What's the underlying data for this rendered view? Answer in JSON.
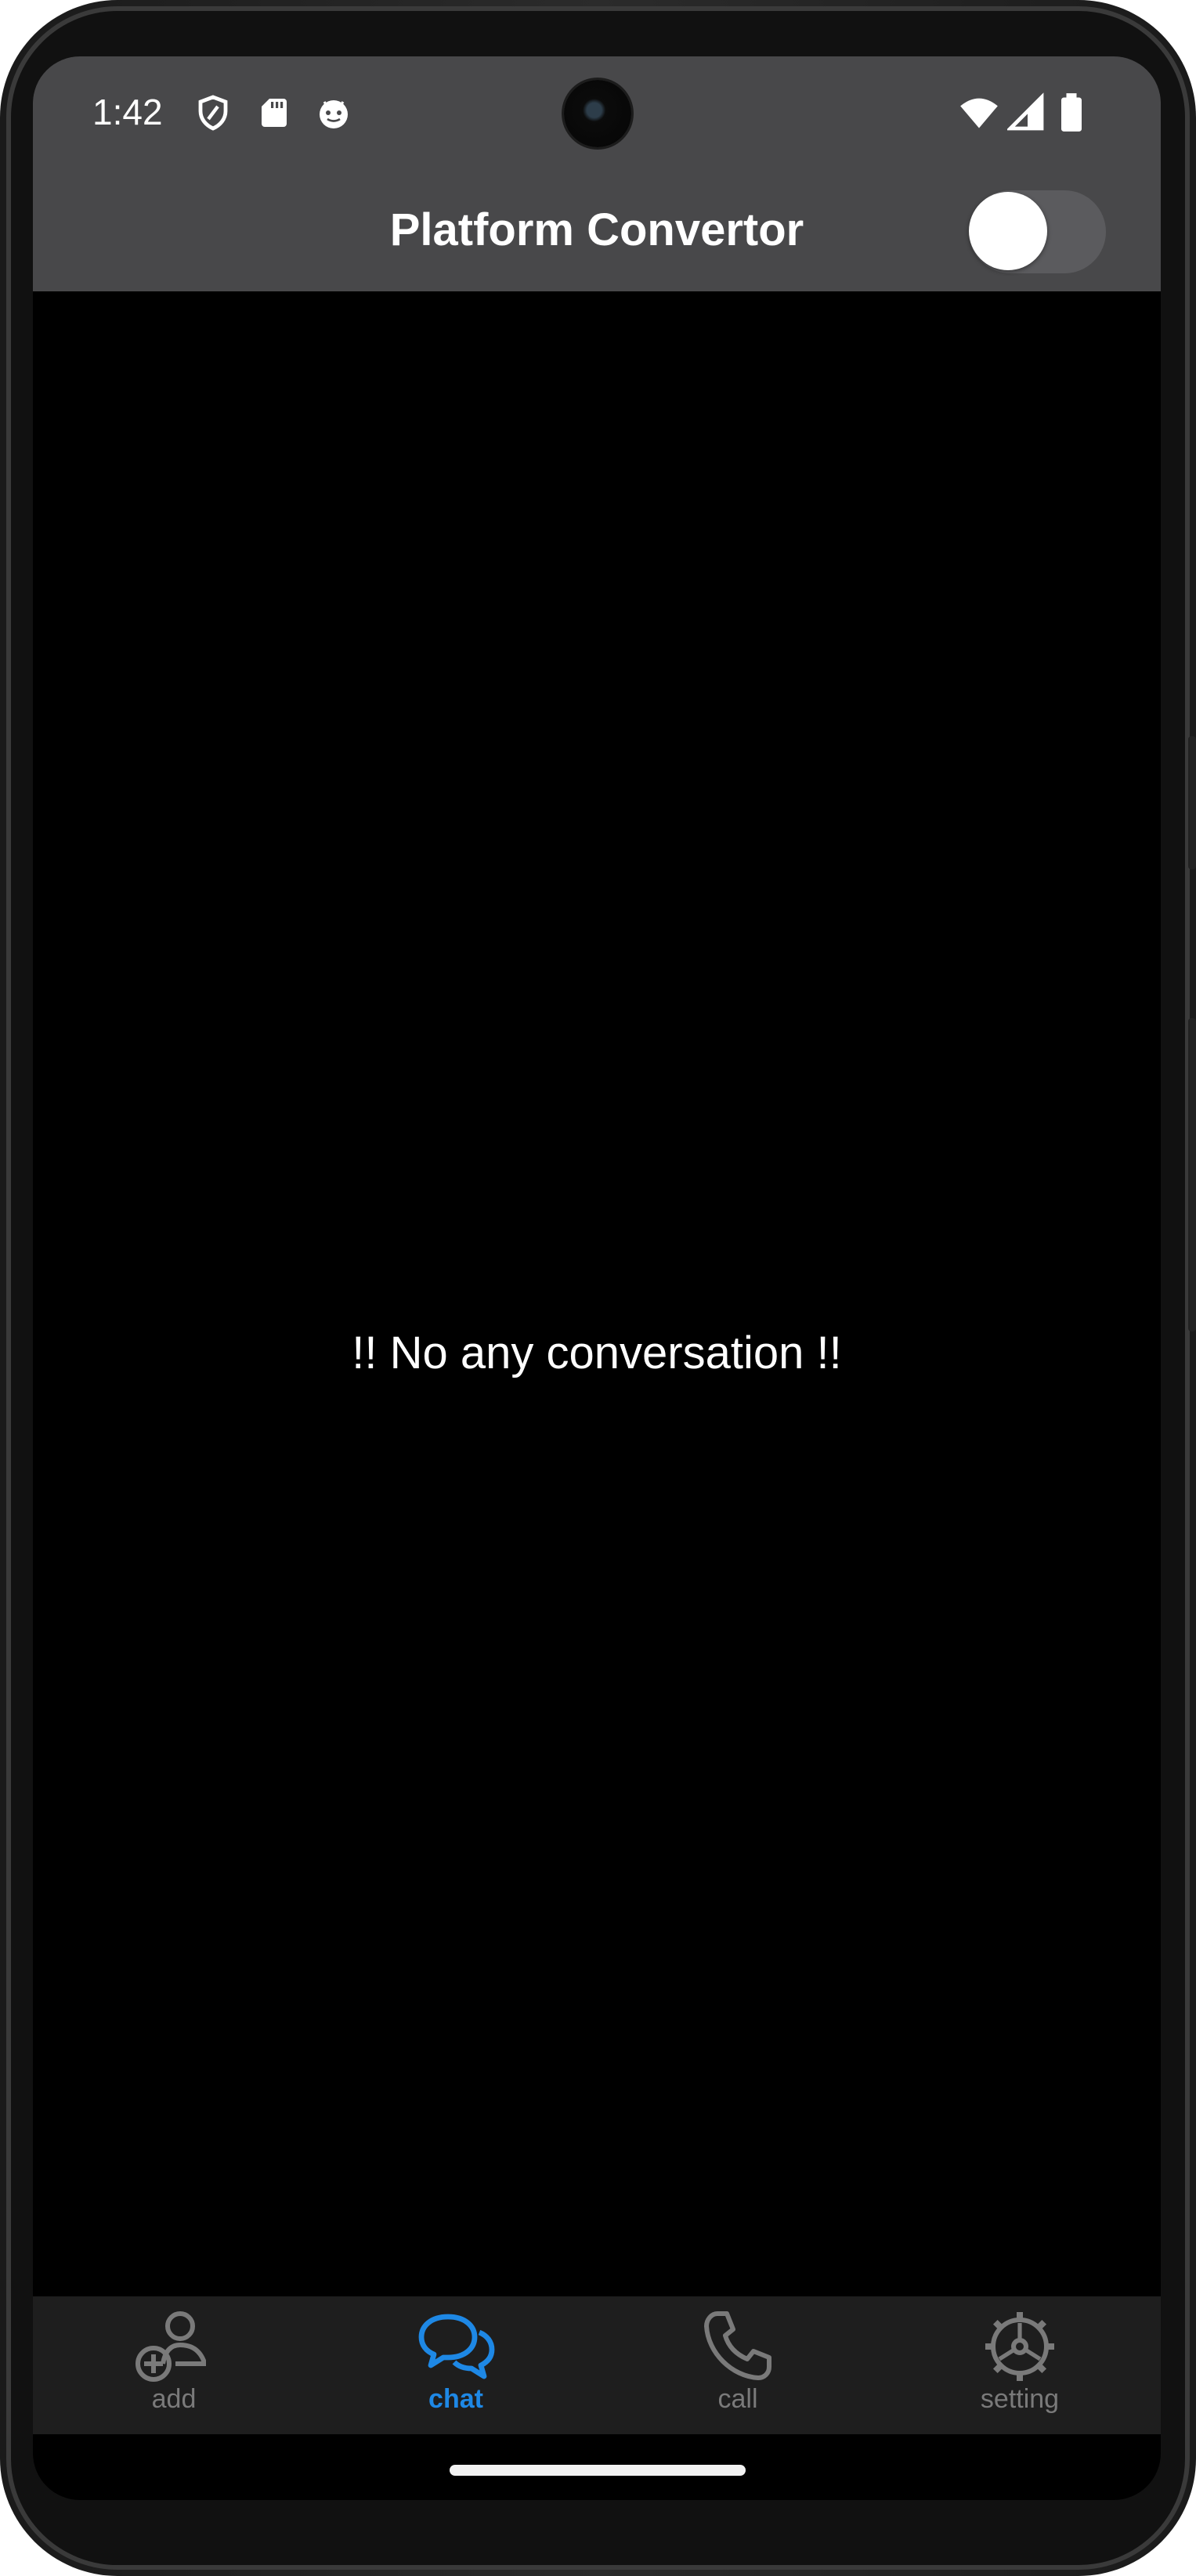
{
  "status_bar": {
    "time": "1:42",
    "left_icons": [
      "shield-icon",
      "sd-card-icon",
      "android-face-icon"
    ],
    "right_icons": [
      "wifi-icon",
      "cell-signal-icon",
      "battery-icon"
    ]
  },
  "app_bar": {
    "title": "Platform Convertor",
    "toggle_on": false
  },
  "main": {
    "empty_message": "!! No any conversation !!"
  },
  "bottom_nav": {
    "items": [
      {
        "label": "add",
        "icon": "add-person-icon",
        "active": false
      },
      {
        "label": "chat",
        "icon": "chat-bubbles-icon",
        "active": true
      },
      {
        "label": "call",
        "icon": "phone-icon",
        "active": false
      },
      {
        "label": "setting",
        "icon": "gear-icon",
        "active": false
      }
    ]
  },
  "colors": {
    "app_bar": "#48484a",
    "background": "#000000",
    "nav_background": "#1e1e1e",
    "active": "#1e88e5",
    "inactive": "#7a7a7a"
  }
}
